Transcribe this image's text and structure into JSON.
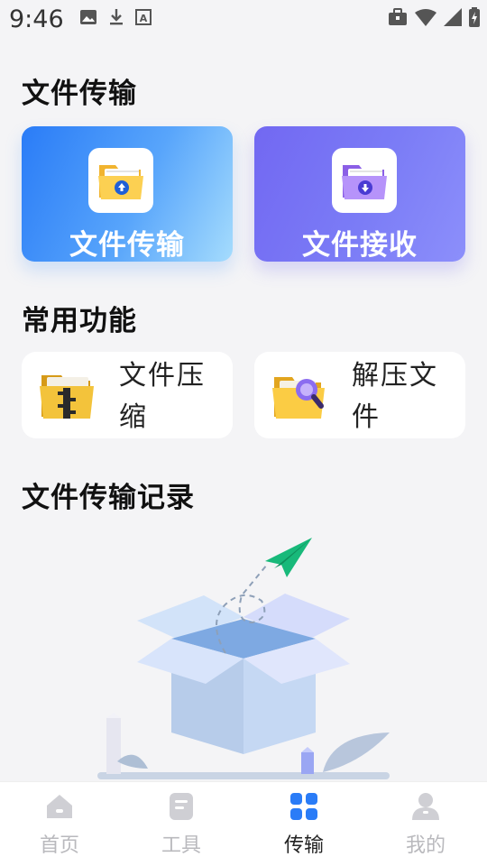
{
  "status_bar": {
    "time": "9:46",
    "left_icons": [
      "image-icon",
      "download-icon",
      "a-icon"
    ],
    "right_icons": [
      "briefcase-icon",
      "wifi-icon",
      "signal-icon",
      "battery-icon"
    ]
  },
  "sections": {
    "transfer_title": "文件传输",
    "functions_title": "常用功能",
    "history_title": "文件传输记录"
  },
  "cards": {
    "send_label": "文件传输",
    "receive_label": "文件接收"
  },
  "functions": {
    "compress_label": "文件压缩",
    "extract_label": "解压文件"
  },
  "nav": {
    "items": [
      {
        "label": "首页",
        "icon": "home-icon"
      },
      {
        "label": "工具",
        "icon": "tools-icon"
      },
      {
        "label": "传输",
        "icon": "grid-icon"
      },
      {
        "label": "我的",
        "icon": "profile-icon"
      }
    ],
    "active_index": 2
  },
  "colors": {
    "send_card": "#2a7cf7",
    "receive_card": "#7268f2",
    "nav_active": "#2a7cf7",
    "nav_inactive": "#b9b9bd"
  }
}
